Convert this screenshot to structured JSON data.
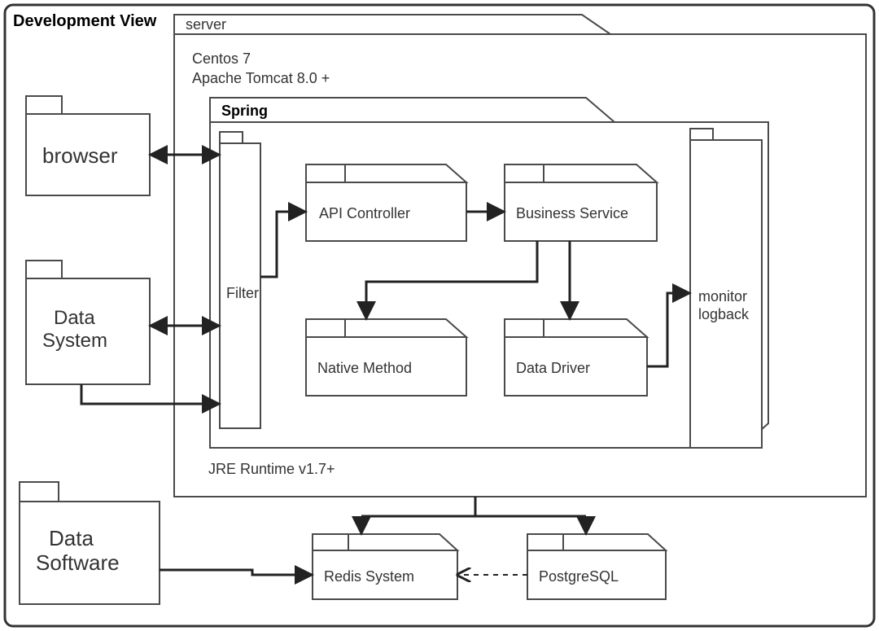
{
  "title": "Development View",
  "server": {
    "label": "server",
    "os": "Centos 7",
    "appserver": "Apache Tomcat 8.0 +",
    "jre": "JRE Runtime v1.7+",
    "spring": {
      "label": "Spring",
      "filter": "Filter",
      "api": "API Controller",
      "business": "Business Service",
      "native": "Native Method",
      "driver": "Data Driver",
      "monitor_l1": "monitor",
      "monitor_l2": "logback"
    }
  },
  "left": {
    "browser": "browser",
    "data_system_l1": "Data",
    "data_system_l2": "System",
    "data_software_l1": "Data",
    "data_software_l2": "Software"
  },
  "bottom": {
    "redis": "Redis System",
    "pg": "PostgreSQL"
  }
}
